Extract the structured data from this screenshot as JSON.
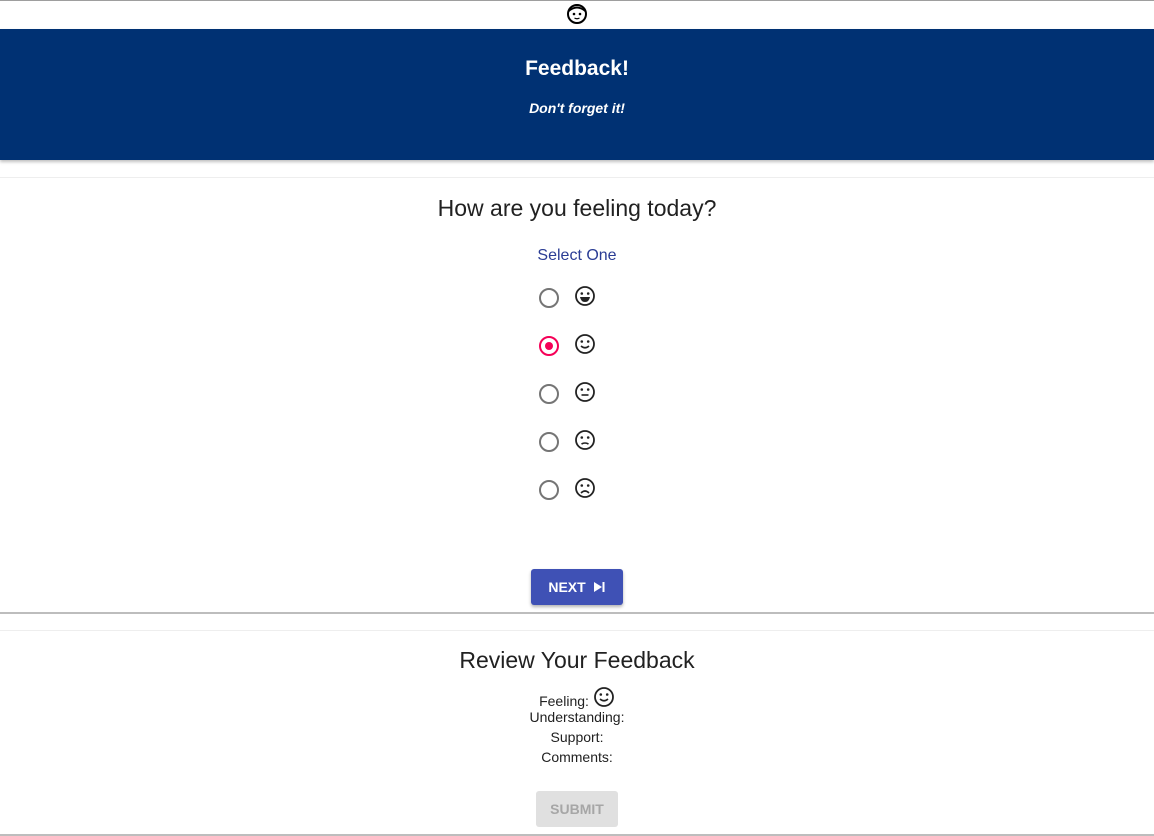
{
  "header": {
    "title": "Feedback!",
    "subtitle": "Don't forget it!"
  },
  "question": {
    "title": "How are you feeling today?",
    "prompt": "Select One",
    "options": [
      {
        "icon": "grinning-face-icon",
        "selected": false
      },
      {
        "icon": "smiling-face-icon",
        "selected": true
      },
      {
        "icon": "neutral-face-icon",
        "selected": false
      },
      {
        "icon": "slightly-frowning-face-icon",
        "selected": false
      },
      {
        "icon": "frowning-face-icon",
        "selected": false
      }
    ],
    "next_label": "NEXT"
  },
  "review": {
    "title": "Review Your Feedback",
    "feeling_label": "Feeling:",
    "feeling_icon": "smiling-face-icon",
    "understanding_label": "Understanding:",
    "support_label": "Support:",
    "comments_label": "Comments:",
    "submit_label": "SUBMIT"
  },
  "colors": {
    "header_bg": "#003173",
    "prompt": "#2a3c94",
    "radio_selected": "#f50057",
    "next_button": "#3f51b5",
    "submit_disabled": "#e0e0e0"
  }
}
